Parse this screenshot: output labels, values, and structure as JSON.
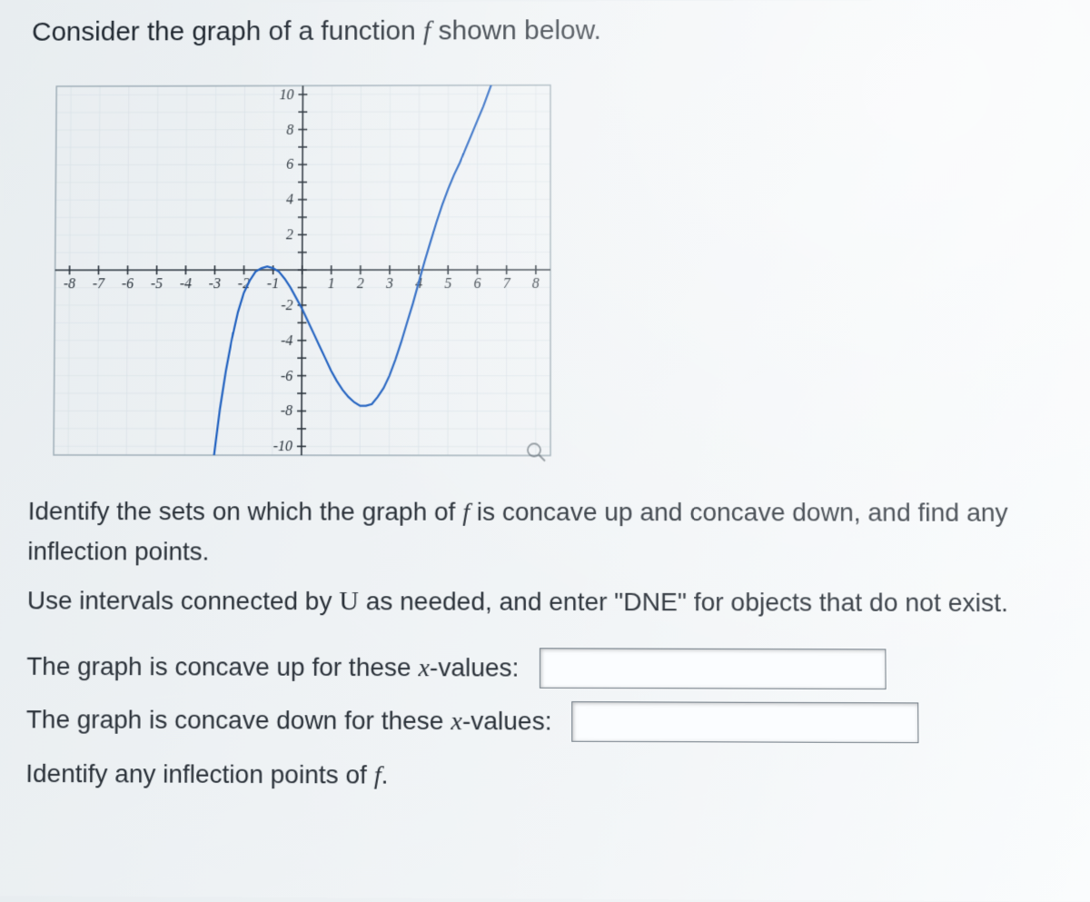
{
  "prompt_prefix": "Consider the graph of a function ",
  "prompt_func": "f",
  "prompt_suffix": " shown below.",
  "chart_data": {
    "type": "line",
    "xlabel": "",
    "ylabel": "",
    "xlim": [
      -8.5,
      8.5
    ],
    "ylim": [
      -10.5,
      10.5
    ],
    "xticks": [
      -8,
      -7,
      -6,
      -5,
      -4,
      -3,
      -2,
      -1,
      1,
      2,
      3,
      4,
      5,
      6,
      7,
      8
    ],
    "yticks": [
      -10,
      -8,
      -6,
      -4,
      -2,
      2,
      4,
      6,
      8,
      10
    ],
    "series": [
      {
        "name": "f",
        "x": [
          -3.0,
          -2.8,
          -2.6,
          -2.4,
          -2.2,
          -2.0,
          -1.8,
          -1.6,
          -1.4,
          -1.2,
          -1.0,
          -0.8,
          -0.6,
          -0.4,
          -0.2,
          0.0,
          0.2,
          0.4,
          0.6,
          0.8,
          1.0,
          1.2,
          1.4,
          1.6,
          1.8,
          2.0,
          2.2,
          2.4,
          2.6,
          2.8,
          3.0,
          3.2,
          3.4,
          3.6,
          3.8,
          4.0,
          4.2,
          4.4,
          4.6,
          4.8,
          5.0,
          5.2,
          5.4,
          5.6,
          5.8,
          6.0,
          6.2,
          6.4,
          6.6,
          6.8,
          7.0
        ],
        "y": [
          -10.6,
          -7.9,
          -5.7,
          -3.9,
          -2.4,
          -1.3,
          -0.6,
          -0.1,
          0.1,
          0.2,
          0.1,
          -0.1,
          -0.5,
          -1.0,
          -1.6,
          -2.2,
          -2.9,
          -3.6,
          -4.3,
          -5.0,
          -5.7,
          -6.3,
          -6.8,
          -7.2,
          -7.5,
          -7.7,
          -7.7,
          -7.6,
          -7.2,
          -6.7,
          -6.0,
          -5.1,
          -4.1,
          -3.0,
          -1.9,
          -0.7,
          0.5,
          1.6,
          2.7,
          3.7,
          4.6,
          5.4,
          6.1,
          6.9,
          7.7,
          8.5,
          9.3,
          10.2,
          11.1,
          12.0,
          12.9
        ]
      }
    ]
  },
  "instructions": {
    "line1_a": "Identify the sets on which the graph of ",
    "line1_f": "f",
    "line1_b": " is concave up and concave down, and find any inflection points.",
    "line2_a": "Use intervals connected by ",
    "line2_u": "U",
    "line2_b": " as needed, and enter \"DNE\" for objects that do not exist."
  },
  "answers": {
    "row1_a": "The graph is concave up for these ",
    "row1_x": "x",
    "row1_b": "-values:",
    "row2_a": "The graph is concave down for these ",
    "row2_x": "x",
    "row2_b": "-values:",
    "row3_a": "Identify any inflection points of ",
    "row3_f": "f",
    "row3_b": ".",
    "input1_value": "",
    "input2_value": ""
  }
}
